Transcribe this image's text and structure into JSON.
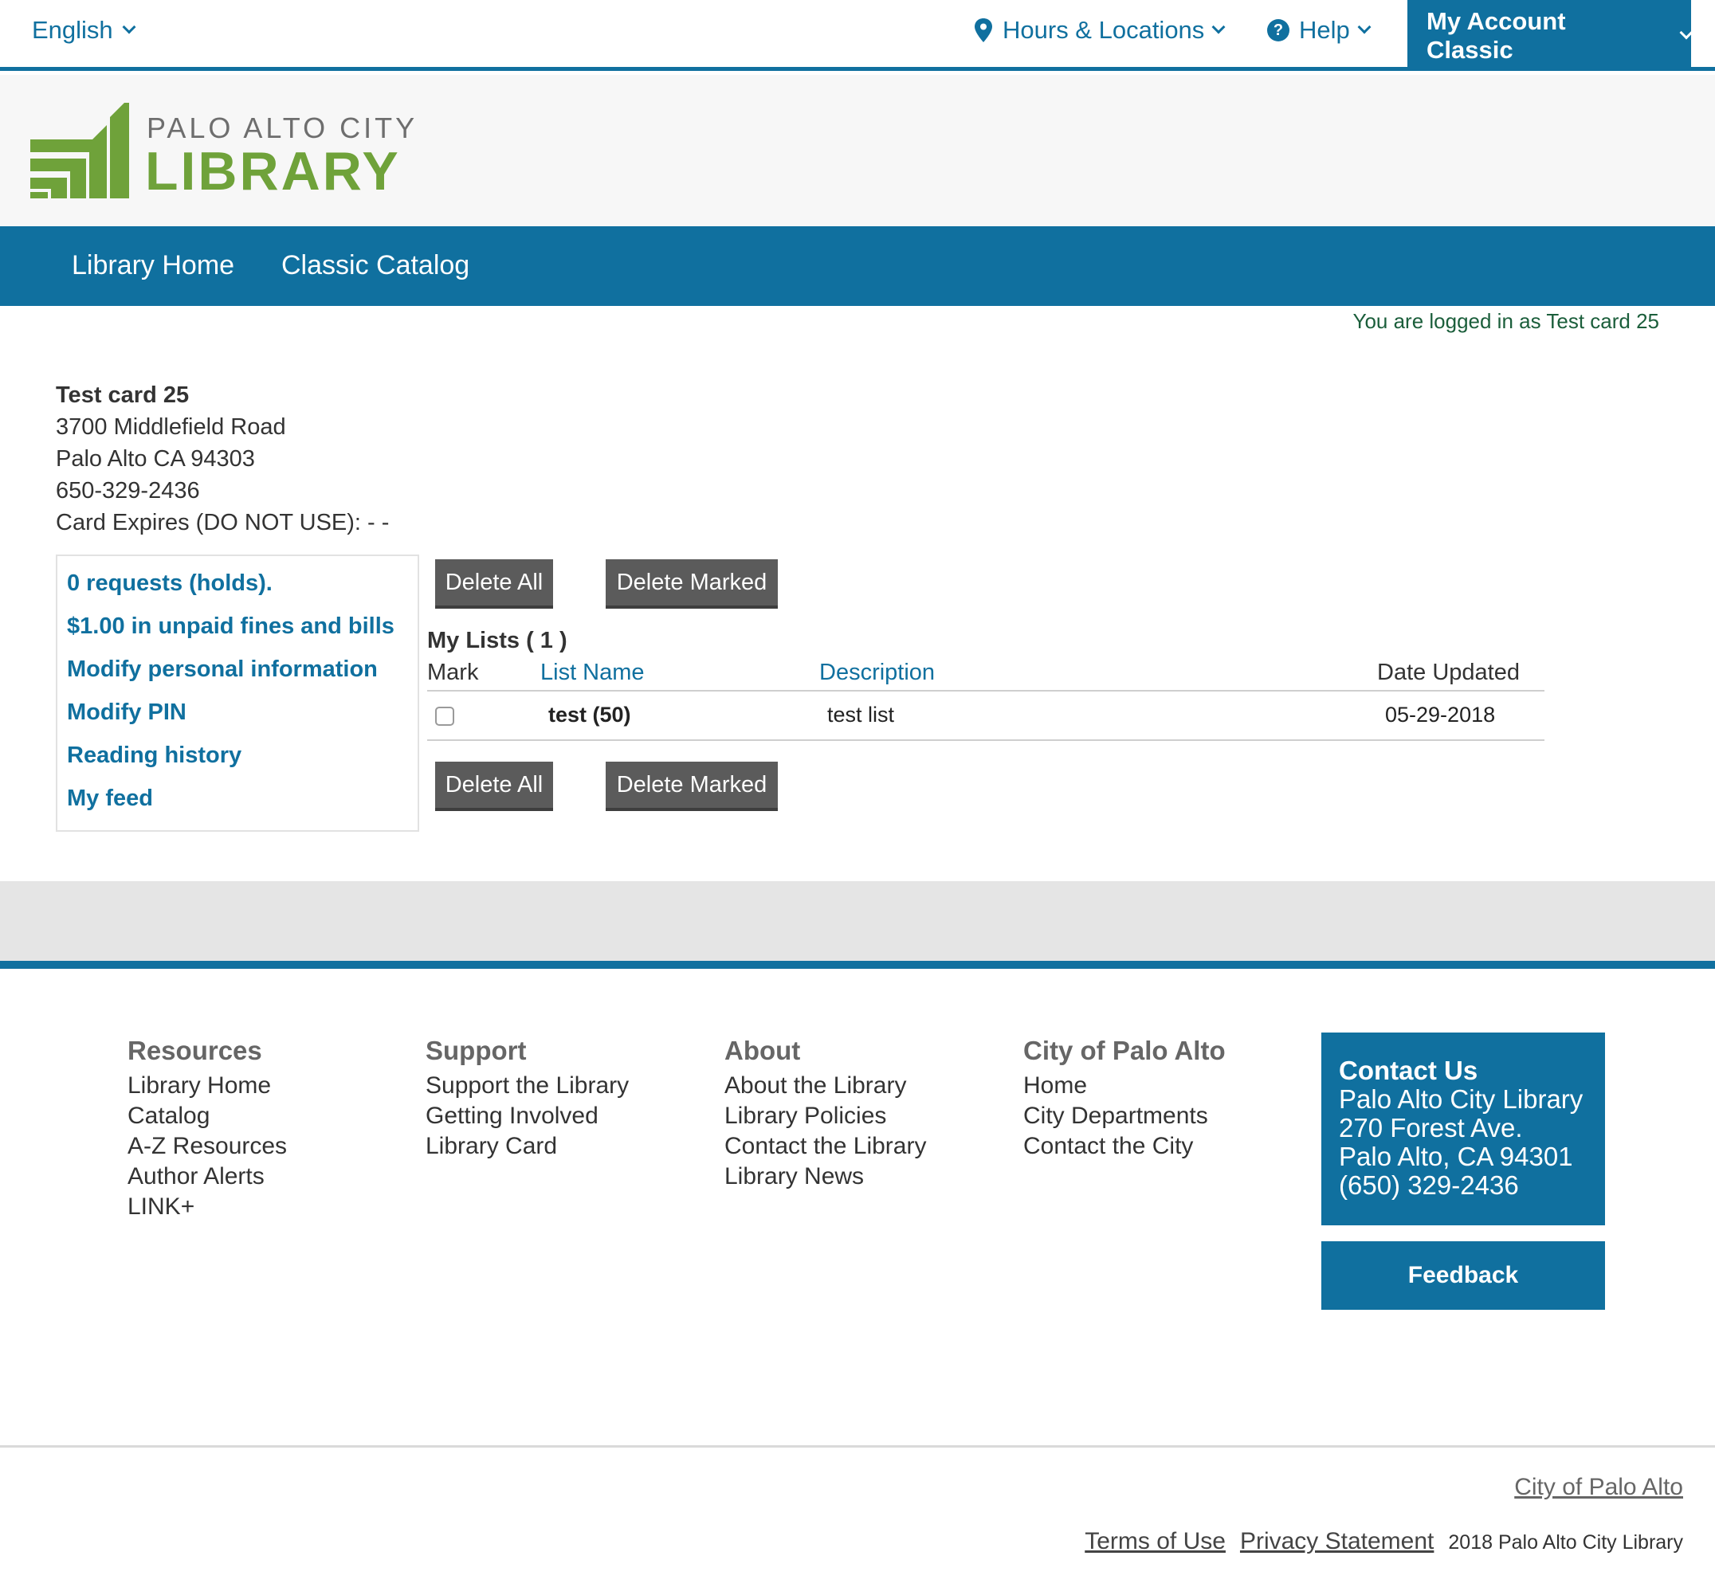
{
  "topbar": {
    "language": "English",
    "hours_locations": "Hours & Locations",
    "help": "Help",
    "account": "My Account Classic"
  },
  "logo": {
    "line1": "PALO ALTO CITY",
    "line2": "LIBRARY",
    "color": "#6fa23a"
  },
  "nav": {
    "items": [
      "Library Home",
      "Classic Catalog"
    ]
  },
  "status": {
    "logged_in": "You are logged in as Test card 25"
  },
  "patron": {
    "name": "Test card 25",
    "address1": "3700 Middlefield Road",
    "address2": "Palo Alto CA 94303",
    "phone": "650-329-2436",
    "card_expires": "Card Expires (DO NOT USE): - -"
  },
  "sidebar": {
    "links": [
      "0 requests (holds).",
      "$1.00 in unpaid fines and bills",
      "Modify personal information",
      "Modify PIN",
      "Reading history",
      "My feed"
    ]
  },
  "lists": {
    "delete_all": "Delete All",
    "delete_marked": "Delete Marked",
    "title": "My Lists ( 1 )",
    "columns": {
      "mark": "Mark",
      "name": "List Name",
      "description": "Description",
      "date": "Date Updated"
    },
    "rows": [
      {
        "name": "test (50)",
        "description": "test list",
        "date": "05-29-2018",
        "checked": false
      }
    ]
  },
  "footer": {
    "columns": [
      {
        "title": "Resources",
        "links": [
          "Library Home",
          "Catalog",
          "A-Z Resources",
          "Author Alerts",
          "LINK+"
        ]
      },
      {
        "title": "Support",
        "links": [
          "Support the Library",
          "Getting Involved",
          "Library Card"
        ]
      },
      {
        "title": "About",
        "links": [
          "About the Library",
          "Library Policies",
          "Contact the Library",
          "Library News"
        ]
      },
      {
        "title": "City of Palo Alto",
        "links": [
          "Home",
          "City Departments",
          "Contact the City"
        ]
      }
    ],
    "contact": {
      "title": "Contact Us",
      "lines": [
        "Palo Alto City Library",
        "270 Forest Ave.",
        "Palo Alto, CA 94301",
        "(650) 329-2436"
      ]
    },
    "feedback": "Feedback",
    "city_link": "City of Palo Alto",
    "terms": "Terms of Use",
    "privacy": "Privacy Statement",
    "copyright": "2018 Palo Alto City Library"
  },
  "colors": {
    "brand_blue": "#10709f",
    "brand_green": "#6fa23a",
    "button_grey": "#5b5b5b"
  }
}
